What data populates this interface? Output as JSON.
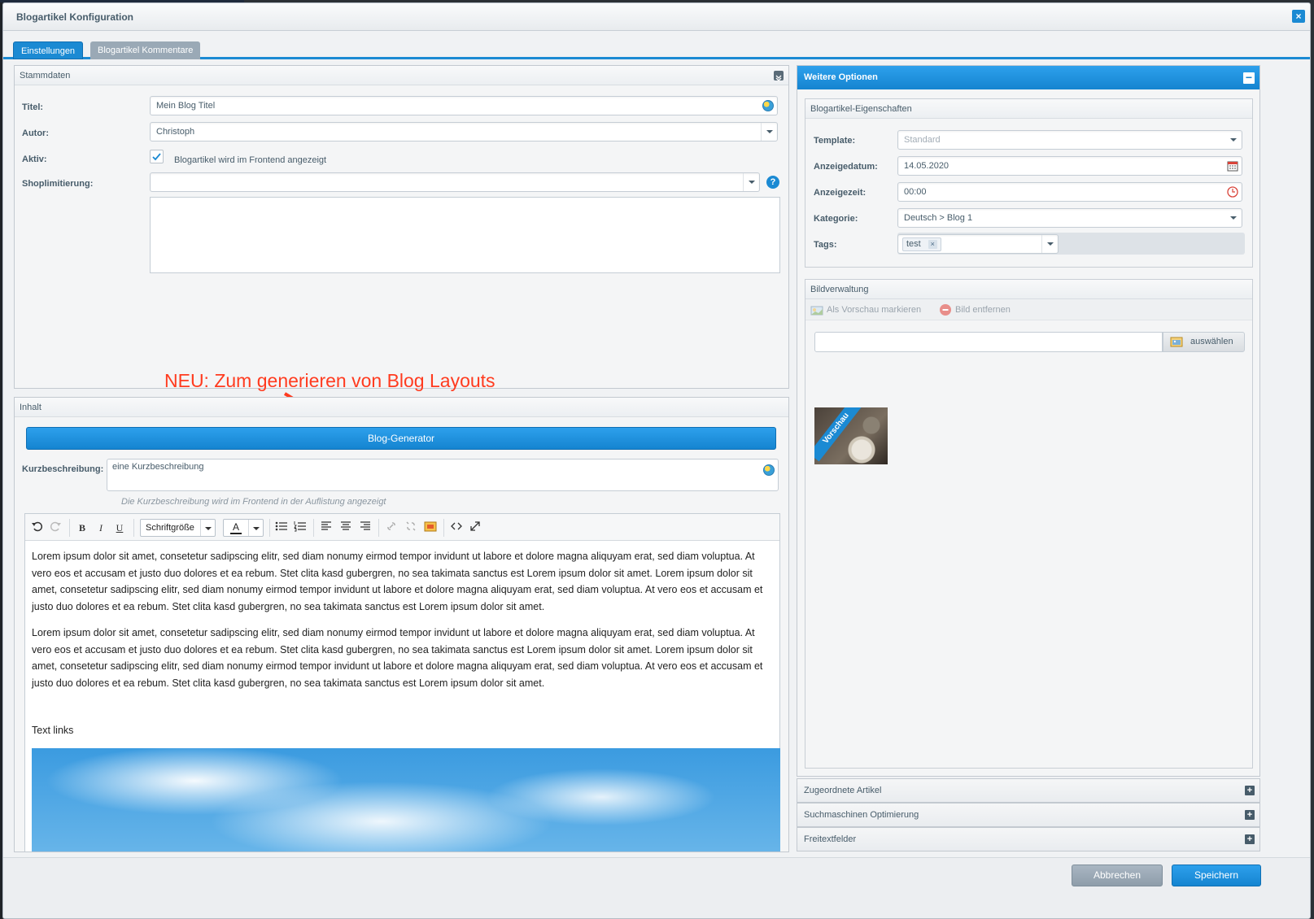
{
  "window": {
    "title": "Blogartikel Konfiguration",
    "close": "×"
  },
  "tabs": [
    {
      "label": "Einstellungen"
    },
    {
      "label": "Blogartikel Kommentare"
    }
  ],
  "stammdaten": {
    "header": "Stammdaten",
    "titel_label": "Titel:",
    "titel_value": "Mein Blog Titel",
    "autor_label": "Autor:",
    "autor_value": "Christoph",
    "aktiv_label": "Aktiv:",
    "aktiv_text": "Blogartikel wird im Frontend angezeigt",
    "shop_label": "Shoplimitierung:",
    "help": "?"
  },
  "annotation": {
    "text": "NEU: Zum generieren von Blog Layouts",
    "color": "#ff3b1f"
  },
  "inhalt": {
    "header": "Inhalt",
    "generator_button": "Blog-Generator",
    "kurz_label": "Kurzbeschreibung:",
    "kurz_value": "eine Kurzbeschreibung",
    "kurz_hint": "Die Kurzbeschreibung wird im Frontend in der Auflistung angezeigt",
    "toolbar": {
      "bold": "B",
      "italic": "I",
      "underline": "U",
      "fontsize": "Schriftgröße",
      "color": "A"
    },
    "paragraph1": "Lorem ipsum dolor sit amet, consetetur sadipscing elitr, sed diam nonumy eirmod tempor invidunt ut labore et dolore magna aliquyam erat, sed diam voluptua. At vero eos et accusam et justo duo dolores et ea rebum. Stet clita kasd gubergren, no sea takimata sanctus est Lorem ipsum dolor sit amet. Lorem ipsum dolor sit amet, consetetur sadipscing elitr, sed diam nonumy eirmod tempor invidunt ut labore et dolore magna aliquyam erat, sed diam voluptua. At vero eos et accusam et justo duo dolores et ea rebum. Stet clita kasd gubergren, no sea takimata sanctus est Lorem ipsum dolor sit amet.",
    "paragraph2": "Lorem ipsum dolor sit amet, consetetur sadipscing elitr, sed diam nonumy eirmod tempor invidunt ut labore et dolore magna aliquyam erat, sed diam voluptua. At vero eos et accusam et justo duo dolores et ea rebum. Stet clita kasd gubergren, no sea takimata sanctus est Lorem ipsum dolor sit amet. Lorem ipsum dolor sit amet, consetetur sadipscing elitr, sed diam nonumy eirmod tempor invidunt ut labore et dolore magna aliquyam erat, sed diam voluptua. At vero eos et accusam et justo duo dolores et ea rebum. Stet clita kasd gubergren, no sea takimata sanctus est Lorem ipsum dolor sit amet.",
    "text_links": "Text links"
  },
  "weitere": {
    "header": "Weitere Optionen",
    "eigenschaften": {
      "header": "Blogartikel-Eigenschaften",
      "template_label": "Template:",
      "template_placeholder": "Standard",
      "datum_label": "Anzeigedatum:",
      "datum_value": "14.05.2020",
      "zeit_label": "Anzeigezeit:",
      "zeit_value": "00:00",
      "kategorie_label": "Kategorie:",
      "kategorie_value": "Deutsch > Blog 1",
      "tags_label": "Tags:",
      "tag": "test",
      "tag_remove": "×"
    },
    "bild": {
      "header": "Bildverwaltung",
      "preview_action": "Als Vorschau markieren",
      "remove_action": "Bild entfernen",
      "select_button": "auswählen",
      "badge": "Vorschau"
    },
    "accordions": [
      {
        "label": "Zugeordnete Artikel"
      },
      {
        "label": "Suchmaschinen Optimierung"
      },
      {
        "label": "Freitextfelder"
      }
    ],
    "collapse": "−",
    "expand": "+"
  },
  "footer": {
    "cancel": "Abbrechen",
    "save": "Speichern"
  }
}
